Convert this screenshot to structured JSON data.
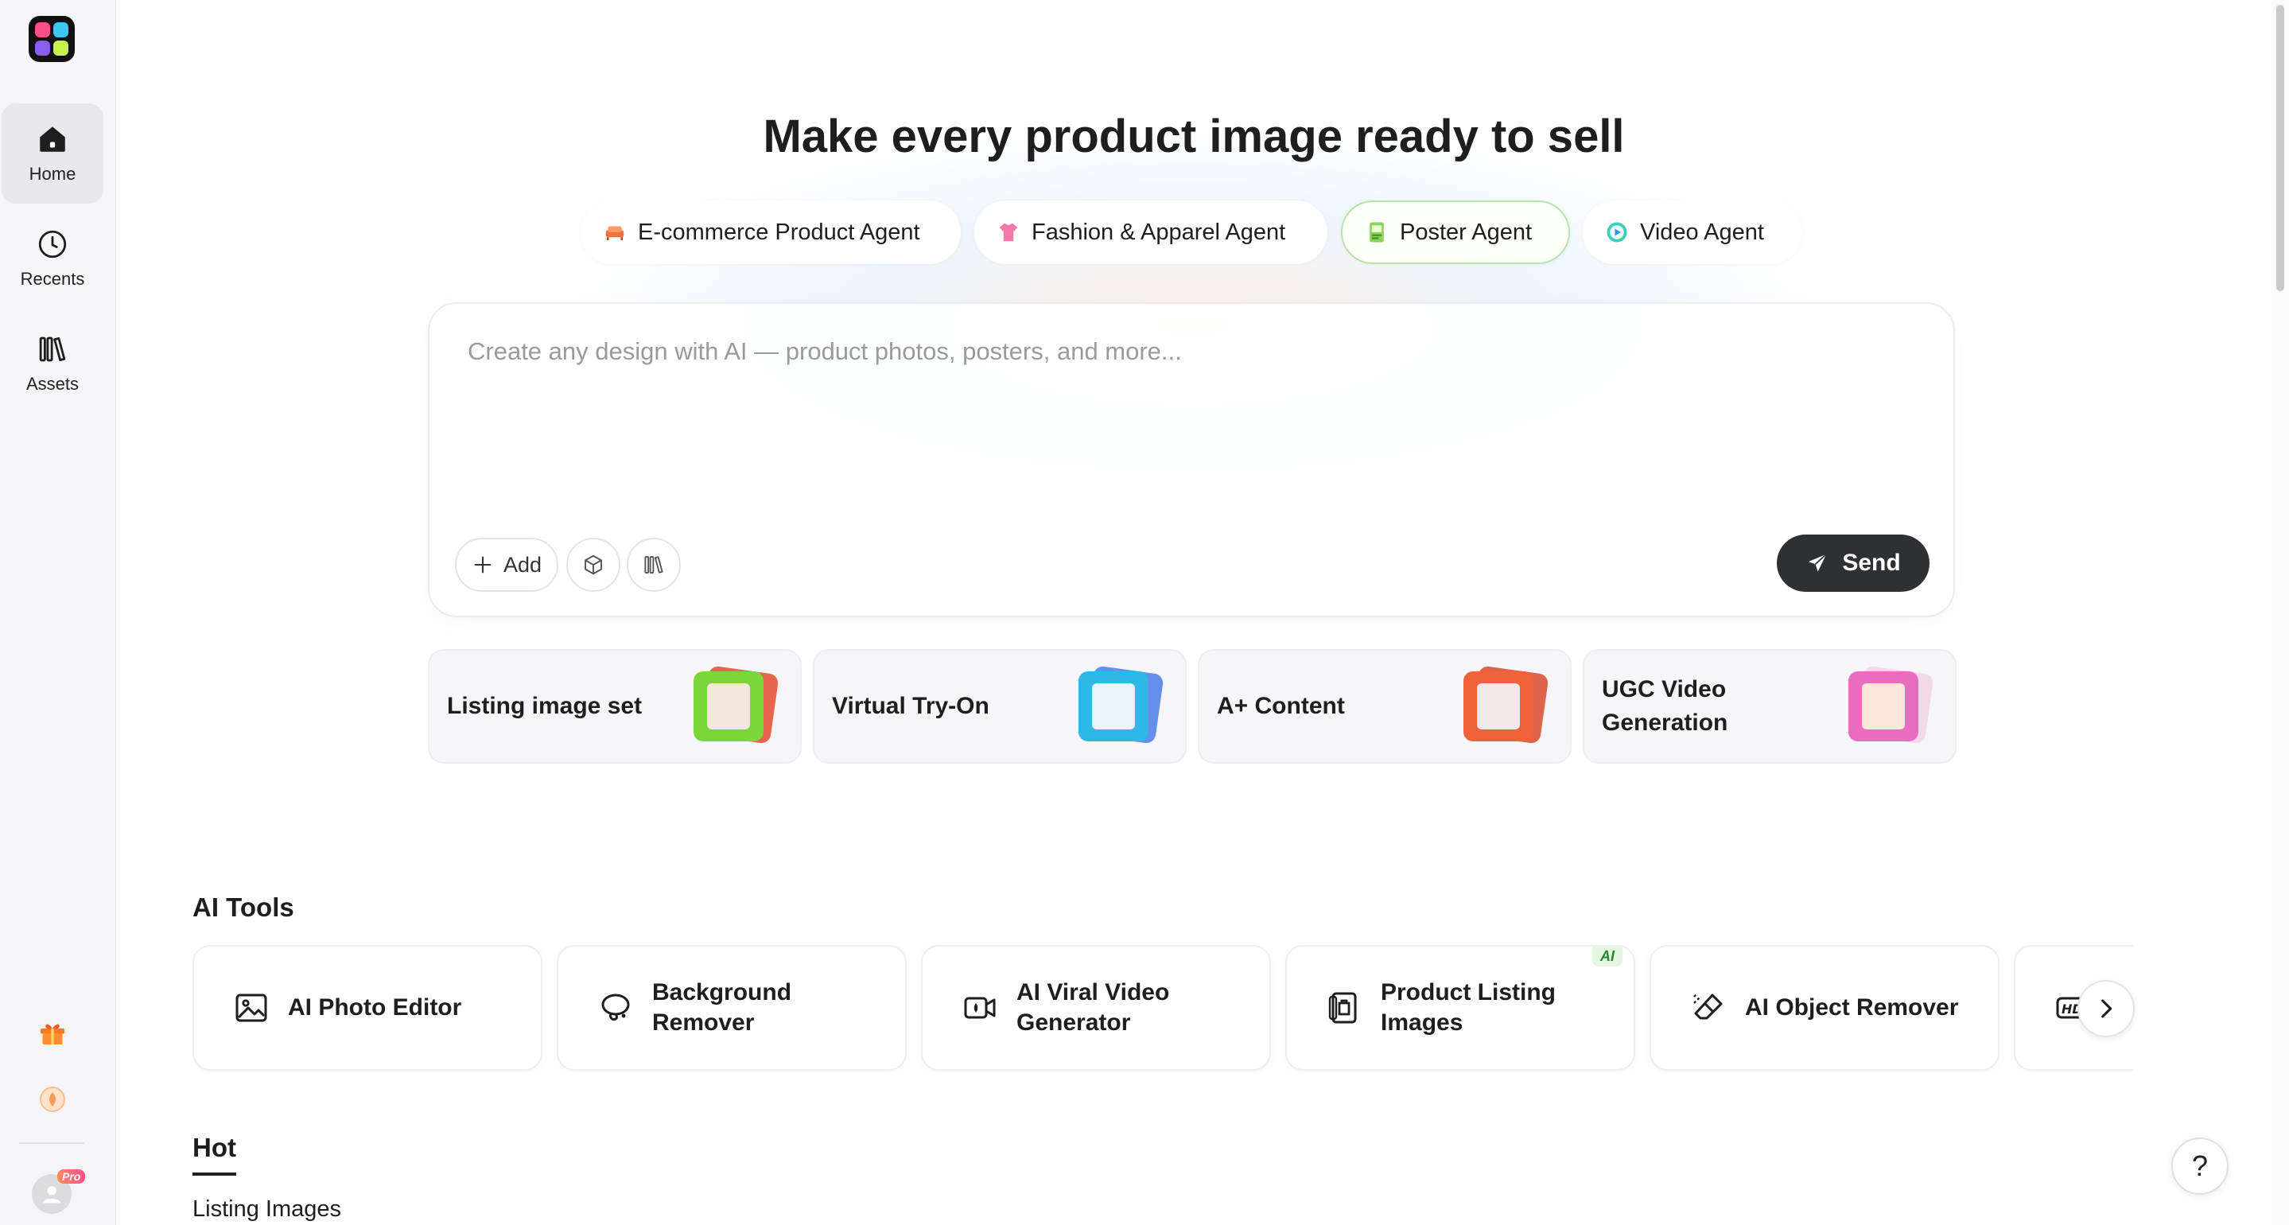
{
  "sidebar": {
    "items": [
      {
        "label": "Home",
        "icon": "home-icon",
        "active": true
      },
      {
        "label": "Recents",
        "icon": "clock-icon"
      },
      {
        "label": "Assets",
        "icon": "library-icon"
      }
    ],
    "bottom": {
      "gift_icon": "gift-icon",
      "coin_icon": "coin-icon",
      "pro_label": "Pro"
    }
  },
  "hero": {
    "title": "Make every product image ready to sell"
  },
  "agents": [
    {
      "label": "E-commerce Product Agent",
      "icon": "sofa-icon",
      "color": "#f2703b"
    },
    {
      "label": "Fashion & Apparel Agent",
      "icon": "shirt-icon",
      "color": "#f27aa8"
    },
    {
      "label": "Poster Agent",
      "icon": "poster-icon",
      "color": "#8bd35a",
      "selected": true
    },
    {
      "label": "Video Agent",
      "icon": "play-icon",
      "color": "#3ccfb8"
    }
  ],
  "prompt": {
    "placeholder": "Create any design with AI — product photos, posters, and more...",
    "add_label": "Add",
    "send_label": "Send"
  },
  "quick_actions": [
    {
      "label": "Listing image set",
      "color": "#7bd63a"
    },
    {
      "label": "Virtual Try-On",
      "color": "#2db8e8"
    },
    {
      "label": "A+ Content",
      "color": "#f0623c"
    },
    {
      "label": "UGC Video Generation",
      "color": "#e96cc0"
    }
  ],
  "ai_tools": {
    "title": "AI Tools",
    "items": [
      {
        "label": "AI Photo Editor",
        "icon": "photo-edit-icon"
      },
      {
        "label": "Background Remover",
        "icon": "lasso-icon"
      },
      {
        "label": "AI Viral Video Generator",
        "icon": "video-camera-icon"
      },
      {
        "label": "Product Listing Images",
        "icon": "listing-icon",
        "badge": "AI"
      },
      {
        "label": "AI Object Remover",
        "icon": "eraser-icon"
      },
      {
        "label": "HD",
        "icon": "hd-icon"
      }
    ]
  },
  "hot": {
    "tab_label": "Hot",
    "sub_heading": "Listing Images"
  },
  "help_label": "?"
}
